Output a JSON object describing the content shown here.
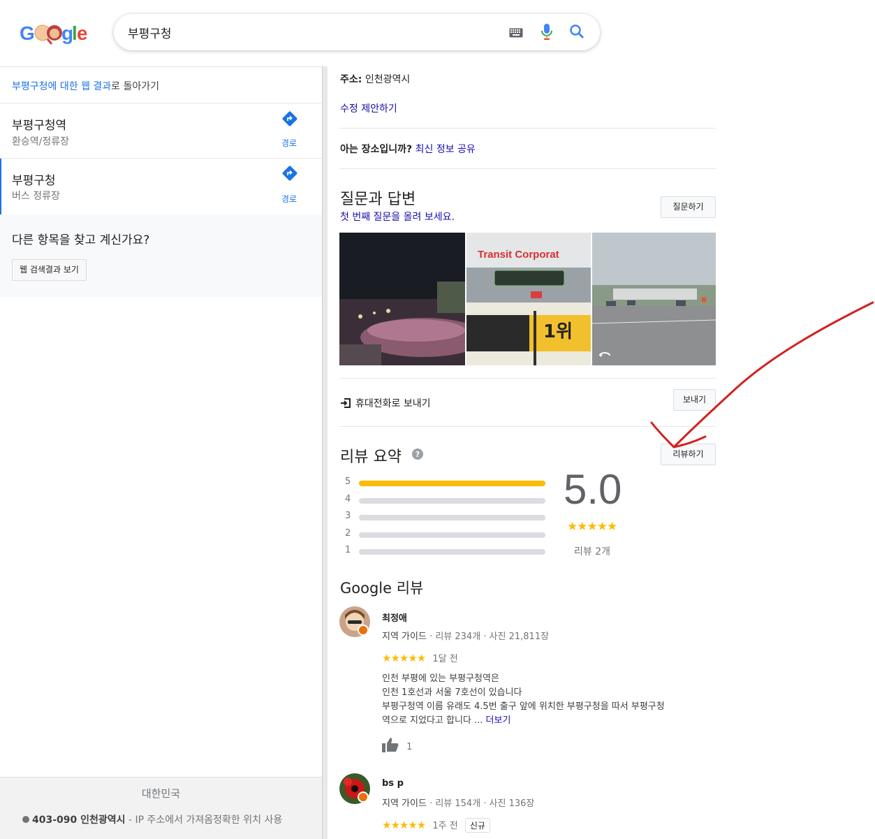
{
  "search": {
    "query": "부평구청"
  },
  "left": {
    "back": {
      "query": "부평구청",
      "mid": "에 대한 웹 결과",
      "tail": "로 돌아가기"
    },
    "places": [
      {
        "name": "부평구청역",
        "type": "환승역/정류장",
        "dir_label": "경로"
      },
      {
        "name": "부평구청",
        "type": "버스 정류장",
        "dir_label": "경로"
      }
    ],
    "other_title": "다른 항목을 찾고 계신가요?",
    "web_button": "웹 검색결과 보기",
    "footer": {
      "country": "대한민국",
      "postal": "403-090 인천광역시",
      "loc_note": " - IP 주소에서 가져옴",
      "precise": "정확한 위치 사용"
    }
  },
  "right": {
    "address_label": "주소:",
    "address_value": "인천광역시",
    "edit_suggest": "수정 제안하기",
    "know_place": "아는 장소입니까?",
    "share_info": "최신 정보 공유",
    "qa_title": "질문과 답변",
    "qa_sub": "첫 번째 질문을 올려 보세요.",
    "ask_button": "질문하기",
    "photo_sign_text": "Transit Corporat",
    "photo_banner": "1위",
    "send_phone": "휴대전화로 보내기",
    "send_button": "보내기",
    "review_summary_title": "리뷰 요약",
    "write_review": "리뷰하기",
    "rating": "5.0",
    "stars": "★★★★★",
    "review_count": "리뷰 2개",
    "rating_bars": [
      {
        "label": "5",
        "fill": 1.0
      },
      {
        "label": "4",
        "fill": 0
      },
      {
        "label": "3",
        "fill": 0
      },
      {
        "label": "2",
        "fill": 0
      },
      {
        "label": "1",
        "fill": 0
      }
    ],
    "google_reviews_title": "Google 리뷰",
    "reviews": [
      {
        "name": "최정애",
        "guide": "지역 가이드",
        "stats": " · 리뷰 234개 · 사진 21,811장",
        "stars": "★★★★★",
        "time": "1달 전",
        "lines": [
          "인천 부평에 있는 부평구청역은",
          "인천 1호선과 서울 7호선이 있습니다",
          "부평구청역 이름 유래도 4.5번 출구 앞에 위치한 부평구청을 따서 부평구청",
          "역으로 지었다고 합니다 ... "
        ],
        "more": "더보기",
        "likes": "1"
      },
      {
        "name": "bs p",
        "guide": "지역 가이드",
        "stats": " · 리뷰 154개 · 사진 136장",
        "stars": "★★★★★",
        "time": "1주 전",
        "tag": "신규"
      }
    ]
  },
  "colors": {
    "accent": "#1a73e8",
    "star": "#fbbc04",
    "arrow": "#d32020"
  }
}
